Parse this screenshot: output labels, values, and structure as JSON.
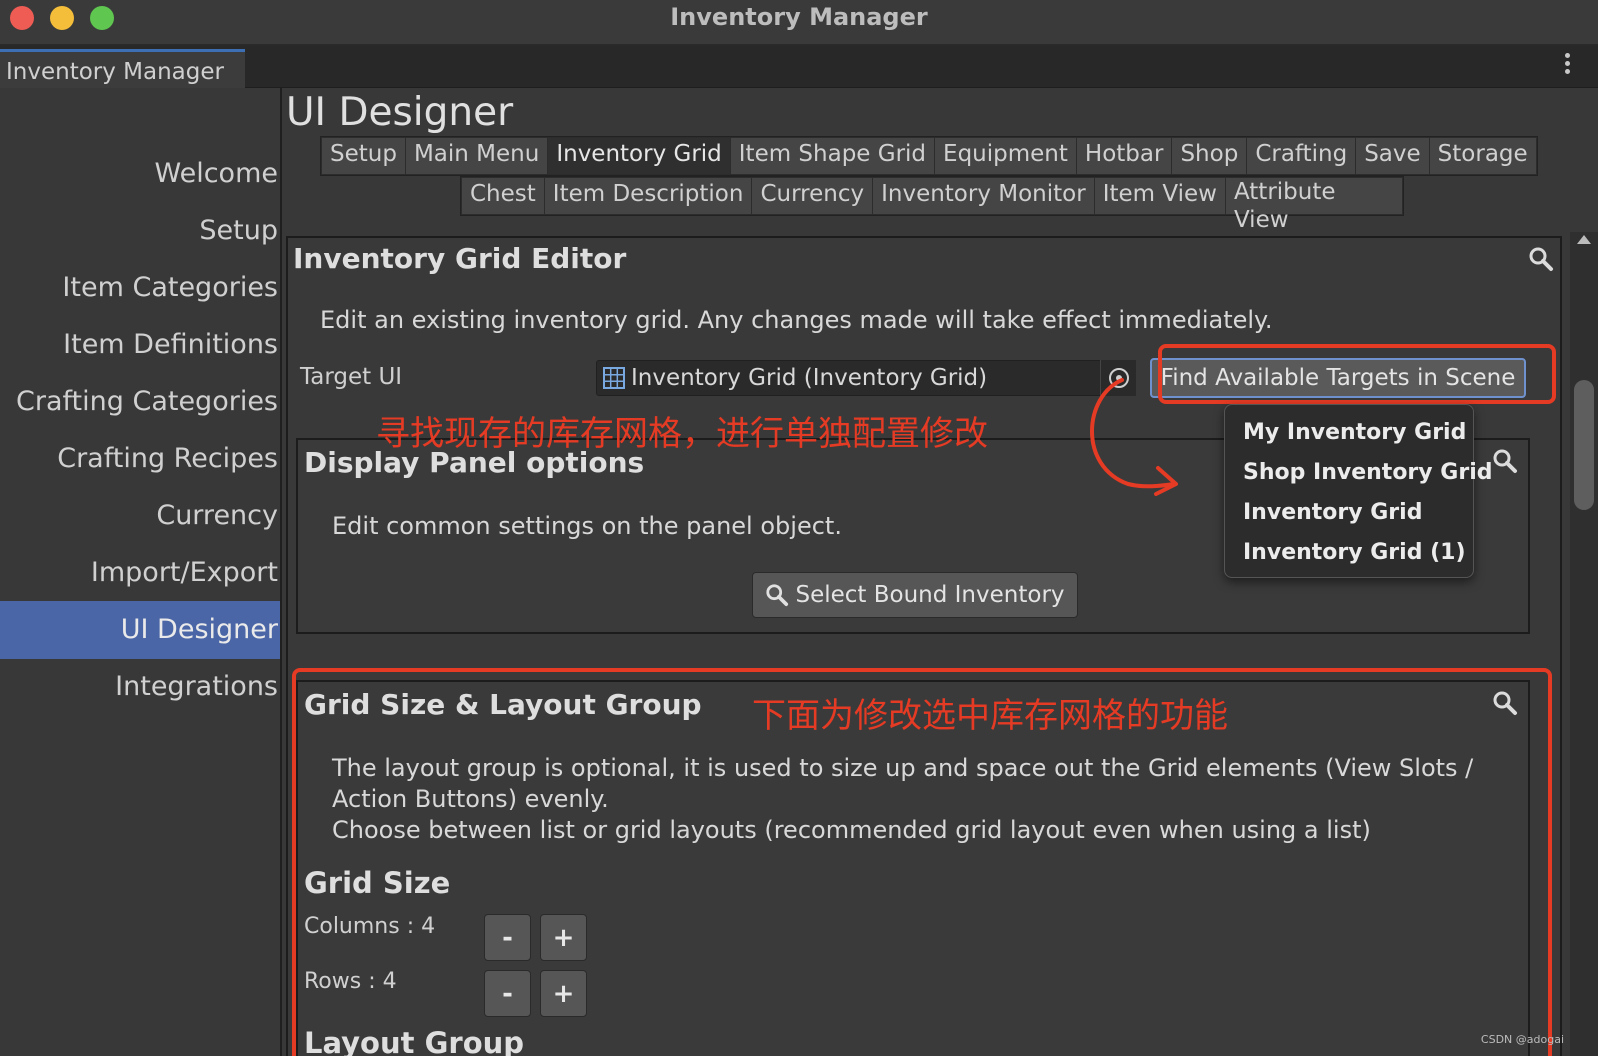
{
  "window": {
    "title": "Inventory Manager",
    "tab_label": "Inventory Manager"
  },
  "sidebar": {
    "items": [
      {
        "label": "Welcome",
        "active": false
      },
      {
        "label": "Setup",
        "active": false
      },
      {
        "label": "Item Categories",
        "active": false
      },
      {
        "label": "Item Definitions",
        "active": false
      },
      {
        "label": "Crafting Categories",
        "active": false
      },
      {
        "label": "Crafting Recipes",
        "active": false
      },
      {
        "label": "Currency",
        "active": false
      },
      {
        "label": "Import/Export",
        "active": false
      },
      {
        "label": "UI Designer",
        "active": true
      },
      {
        "label": "Integrations",
        "active": false
      }
    ]
  },
  "main": {
    "title": "UI Designer",
    "tabs_row1": [
      "Setup",
      "Main Menu",
      "Inventory Grid",
      "Item Shape Grid",
      "Equipment",
      "Hotbar",
      "Shop",
      "Crafting",
      "Save",
      "Storage"
    ],
    "tabs_row2": [
      "Chest",
      "Item Description",
      "Currency",
      "Inventory Monitor",
      "Item View",
      "Attribute View"
    ],
    "active_tab": "Inventory Grid"
  },
  "editor": {
    "title": "Inventory Grid Editor",
    "description": "Edit an existing inventory grid. Any changes made will take effect immediately.",
    "target_label": "Target UI",
    "target_value": "Inventory Grid (Inventory Grid)",
    "find_button": "Find Available Targets in Scene"
  },
  "dropdown": {
    "items": [
      "My Inventory Grid",
      "Shop Inventory Grid",
      "Inventory Grid",
      "Inventory Grid (1)"
    ]
  },
  "annotations": {
    "find_note": "寻找现存的库存网格，进行单独配置修改",
    "section_note": "下面为修改选中库存网格的功能"
  },
  "display_panel": {
    "title": "Display Panel options",
    "description": "Edit common settings on the panel object.",
    "button": "Select Bound Inventory"
  },
  "grid_panel": {
    "title": "Grid Size & Layout Group",
    "desc_line1": "The layout group is optional, it is used to size up and space out the Grid elements (View Slots /",
    "desc_line2": "Action Buttons) evenly.",
    "desc_line3": "Choose between list or grid layouts (recommended grid layout even when using a list)",
    "grid_size_heading": "Grid Size",
    "columns_label": "Columns : 4",
    "rows_label": "Rows : 4",
    "minus": "-",
    "plus": "+",
    "layout_group_heading": "Layout Group"
  },
  "watermark": "CSDN @adogai",
  "colors": {
    "accent_blue": "#4b66a6",
    "annotation_red": "#e53b24",
    "background": "#383838"
  }
}
